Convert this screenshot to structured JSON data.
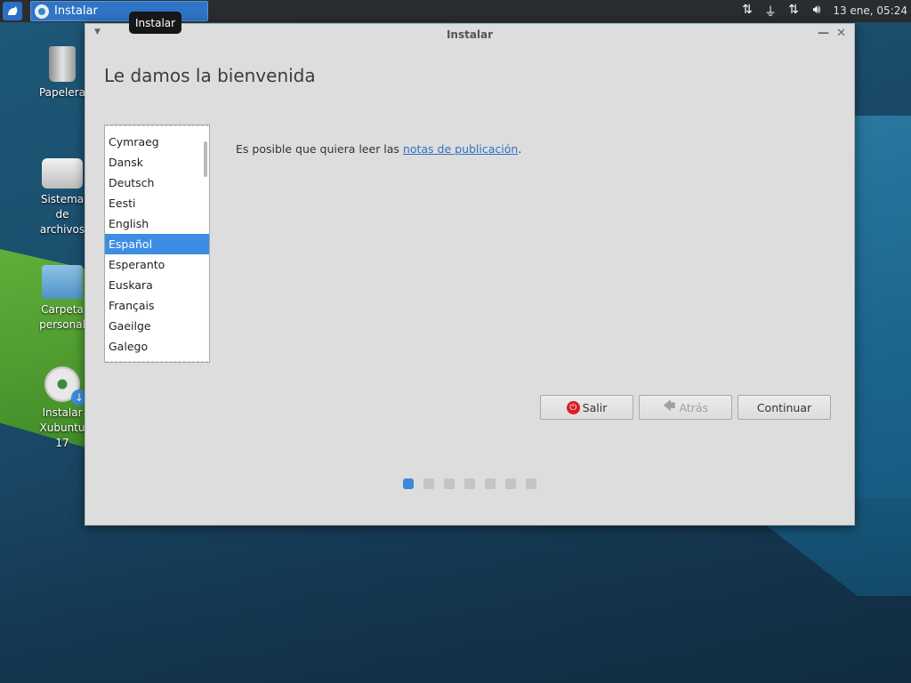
{
  "panel": {
    "task_label": "Instalar",
    "clock": "13 ene, 05:24",
    "tray_icons": [
      "network-updown-icon",
      "power-plug-icon",
      "network-updown-icon",
      "volume-icon"
    ]
  },
  "tooltip": "Instalar",
  "desktop_icons": [
    {
      "name": "trash-icon",
      "label": "Papelera"
    },
    {
      "name": "filesystem-icon",
      "label": "Sistema de archivos"
    },
    {
      "name": "home-folder-icon",
      "label": "Carpeta personal"
    },
    {
      "name": "install-disc-icon",
      "label": "Instalar Xubuntu 17"
    }
  ],
  "window": {
    "title": "Instalar",
    "heading": "Le damos la bienvenida",
    "languages": [
      "Cymraeg",
      "Dansk",
      "Deutsch",
      "Eesti",
      "English",
      "Español",
      "Esperanto",
      "Euskara",
      "Français",
      "Gaeilge",
      "Galego"
    ],
    "selected_language": "Español",
    "notes_prefix": "Es posible que quiera leer las ",
    "notes_link": "notas de publicación",
    "notes_suffix": ".",
    "buttons": {
      "quit": "Salir",
      "back": "Atrás",
      "continue": "Continuar"
    },
    "progress": {
      "total_steps": 7,
      "current_step": 1
    }
  },
  "colors": {
    "accent": "#3d8ee3",
    "panel_bg": "#2a2d30",
    "window_bg": "#dddddd",
    "quit_red": "#d92020"
  }
}
